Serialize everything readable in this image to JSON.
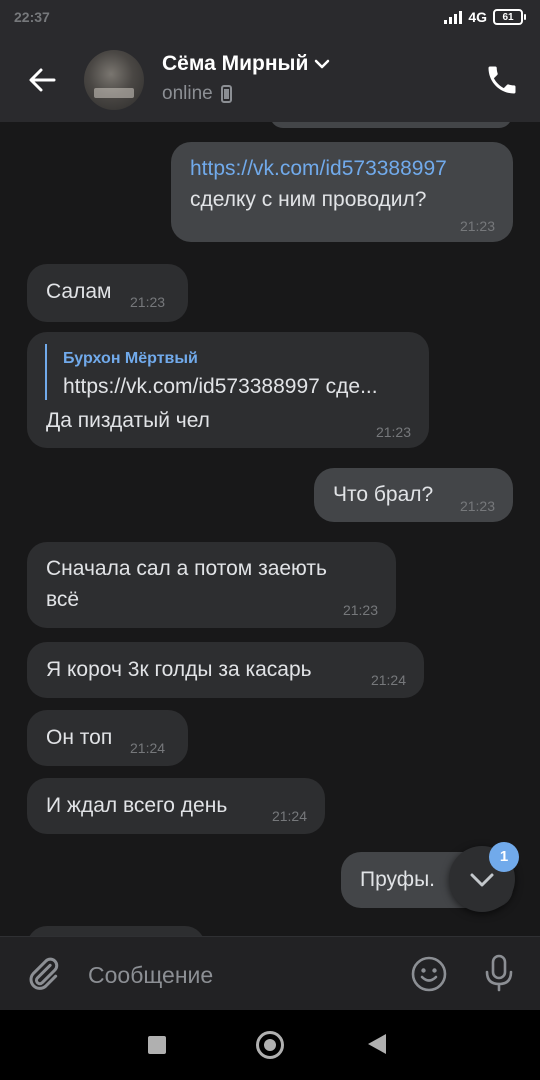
{
  "status_bar": {
    "time": "22:37",
    "network": "4G",
    "battery": "61"
  },
  "header": {
    "name": "Сёма Мирный",
    "status": "online"
  },
  "messages": [
    {
      "dir": "out",
      "link": "https://vk.com/id573388997",
      "text": "сделку с ним проводил?",
      "time": "21:23"
    },
    {
      "dir": "in",
      "text": "Салам",
      "time": "21:23"
    },
    {
      "dir": "in",
      "reply_author": "Бурхон Мёртвый",
      "reply_text": "https://vk.com/id573388997 сде...",
      "text": "Да пиздатый чел",
      "time": "21:23"
    },
    {
      "dir": "out",
      "text": "Что брал?",
      "time": "21:23"
    },
    {
      "dir": "in",
      "text_line1": "Сначала сал а потом заеють",
      "text_line2": "всё",
      "time": "21:23"
    },
    {
      "dir": "in",
      "text": "Я короч 3к голды за касарь",
      "time": "21:24"
    },
    {
      "dir": "in",
      "text": "Он топ",
      "time": "21:24"
    },
    {
      "dir": "in",
      "text": "И ждал всего день",
      "time": "21:24"
    },
    {
      "dir": "out",
      "text": "Пруфы."
    }
  ],
  "unread_badge": "1",
  "composer": {
    "placeholder": "Сообщение"
  },
  "icons": {
    "back": "arrow-left-icon",
    "chevron": "chevron-down-icon",
    "device": "phone-device-icon",
    "call": "phone-icon",
    "scroll": "chevron-down-icon",
    "attach": "paperclip-icon",
    "emoji": "smile-icon",
    "mic": "mic-icon"
  },
  "colors": {
    "accent": "#71aaeb",
    "background": "#181819",
    "header": "#2a2a2d",
    "bubble_in": "#2d2e30",
    "bubble_out": "#434548"
  }
}
